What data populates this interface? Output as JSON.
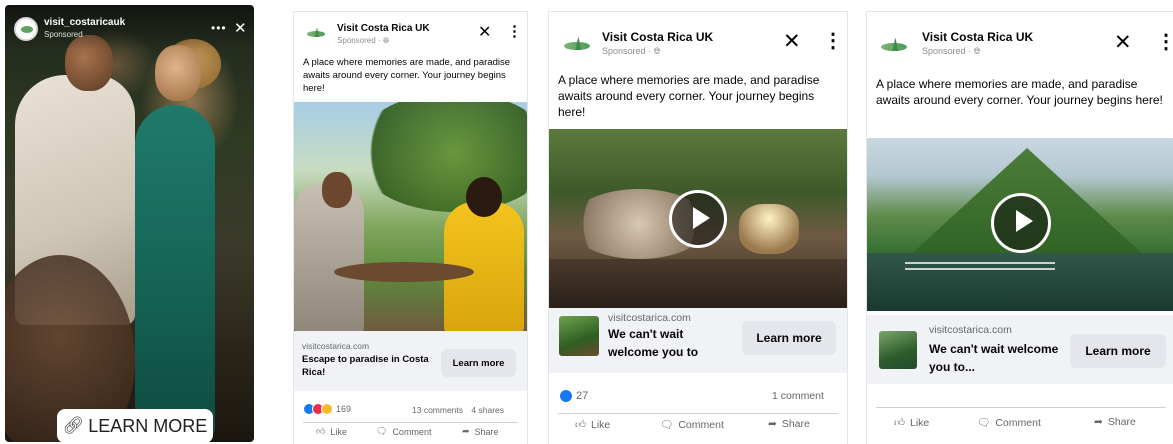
{
  "story": {
    "handle": "visit_costaricauk",
    "sponsored": "Sponsored",
    "more_icon": "more-horizontal-icon",
    "close_icon": "close-icon",
    "cta_icon": "link-icon",
    "cta_label": "LEARN MORE"
  },
  "cards": [
    {
      "page_name": "Visit Costa Rica UK",
      "sponsored": "Sponsored",
      "body": "A place where memories are made, and paradise awaits around every corner. Your journey begins here!",
      "domain": "visitcostarica.com",
      "headline": "Escape to paradise in Costa Rica!",
      "cta_label": "Learn more",
      "reaction_count": "169",
      "comments": "13 comments",
      "shares": "4 shares",
      "actions": {
        "like": "Like",
        "comment": "Comment",
        "share": "Share"
      }
    },
    {
      "page_name": "Visit Costa Rica UK",
      "sponsored": "Sponsored",
      "body": "A place where memories are made, and paradise awaits around every corner. Your journey begins here!",
      "domain": "visitcostarica.com",
      "headline": "We can't wait welcome you to",
      "cta_label": "Learn more",
      "reaction_count": "27",
      "comments": "1 comment",
      "actions": {
        "like": "Like",
        "comment": "Comment",
        "share": "Share"
      }
    },
    {
      "page_name": "Visit Costa Rica UK",
      "sponsored": "Sponsored",
      "body": "A place where memories are made, and paradise awaits around every corner. Your journey begins here!",
      "domain": "visitcostarica.com",
      "headline": "We can't wait welcome you to...",
      "cta_label": "Learn more",
      "actions": {
        "like": "Like",
        "comment": "Comment",
        "share": "Share"
      }
    }
  ],
  "colors": {
    "like_blue": "#1877f2",
    "love_red": "#f02849",
    "haha_yellow": "#f7b928",
    "button_grey": "#e4e6eb",
    "cta_strip": "#f0f2f5"
  }
}
